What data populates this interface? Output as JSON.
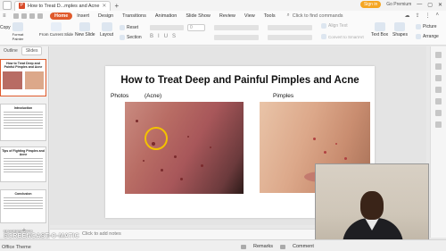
{
  "titlebar": {
    "tab_title": "How to Treat D...mples and Acne",
    "signin_label": "Sign in",
    "go_premium": "Go Premium"
  },
  "ribbon": {
    "tabs": [
      "Menu",
      "Home",
      "Insert",
      "Design",
      "Transitions",
      "Animation",
      "Slide Show",
      "Review",
      "View",
      "Tools"
    ],
    "active_tab": "Home",
    "find_placeholder": "Click to find commands"
  },
  "toolbar": {
    "copy_label": "Copy",
    "format_painter_label": "Format Painter",
    "play_label": "Play",
    "from_current_slide_label": "From Current Slide",
    "new_slide_label": "New Slide",
    "layout_label": "Layout",
    "reset_label": "Reset",
    "section_label": "Section",
    "font_size_value": "0",
    "convert_to_smartart_label": "Convert to SmartArt",
    "align_text_label": "Align Text",
    "text_box_label": "Text Box",
    "shapes_label": "Shapes",
    "picture_label": "Picture",
    "arrange_label": "Arrange"
  },
  "left_panel": {
    "tabs": [
      "Outline",
      "Slides"
    ],
    "active_tab": "Slides",
    "thumbnails": [
      {
        "title": "How to Treat Deep and Painful Pimples and Acne",
        "selected": true
      },
      {
        "title": "Introduction",
        "selected": false
      },
      {
        "title": "Tips of Fighting Pimples and Acne",
        "selected": false
      },
      {
        "title": "Conclusion",
        "selected": false
      }
    ]
  },
  "slide": {
    "title": "How to Treat Deep and Painful Pimples and Acne",
    "label_photos": "Photos",
    "label_acne": "(Acne)",
    "label_pimples": "Pimples"
  },
  "notes": {
    "placeholder": "Click to add notes"
  },
  "statusbar": {
    "theme": "Office Theme",
    "remarks_label": "Remarks",
    "comment_label": "Comment",
    "watermark_top": "RECORDED WITH",
    "watermark_main": "SCREENCAST-O-MATIC"
  }
}
